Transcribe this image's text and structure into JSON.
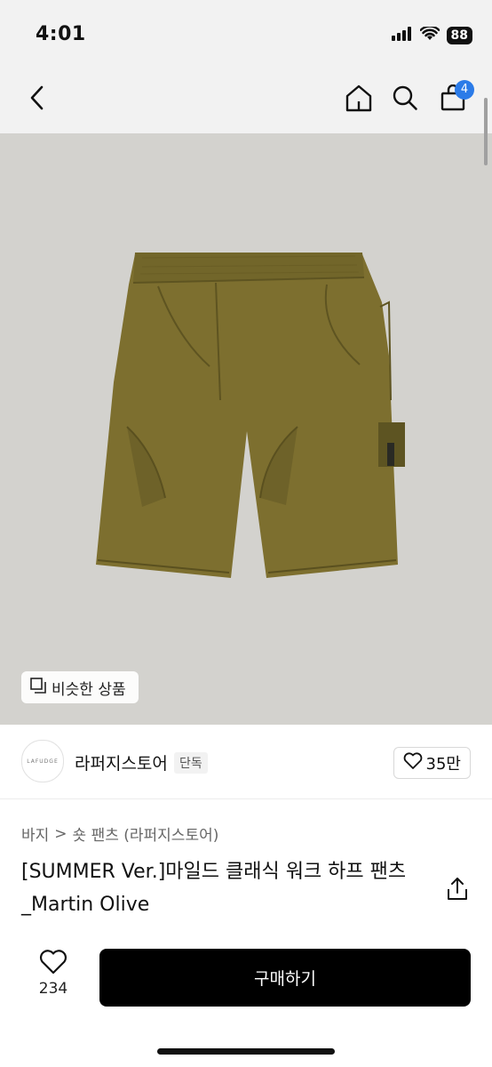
{
  "status": {
    "time": "4:01",
    "battery": "88"
  },
  "nav": {
    "cart_count": "4"
  },
  "image": {
    "similar_label": "비슷한 상품"
  },
  "store": {
    "logo_text": "LAFUDGE",
    "name": "라퍼지스토어",
    "badge": "단독",
    "likes": "35만"
  },
  "breadcrumb": {
    "category": "바지",
    "sep": ">",
    "subcategory": "숏 팬츠 (라퍼지스토어)"
  },
  "product": {
    "title": "[SUMMER Ver.]마일드 클래식 워크 하프 팬츠_Martin Olive"
  },
  "bottom": {
    "wish_count": "234",
    "buy_label": "구매하기"
  },
  "colors": {
    "accent": "#2b7be8",
    "image_bg": "#d3d2ce",
    "pants": "#7d6f2f"
  },
  "icons": [
    "back-icon",
    "home-icon",
    "search-icon",
    "cart-icon",
    "heart-icon",
    "share-icon",
    "copy-icon",
    "signal-icon",
    "wifi-icon"
  ]
}
